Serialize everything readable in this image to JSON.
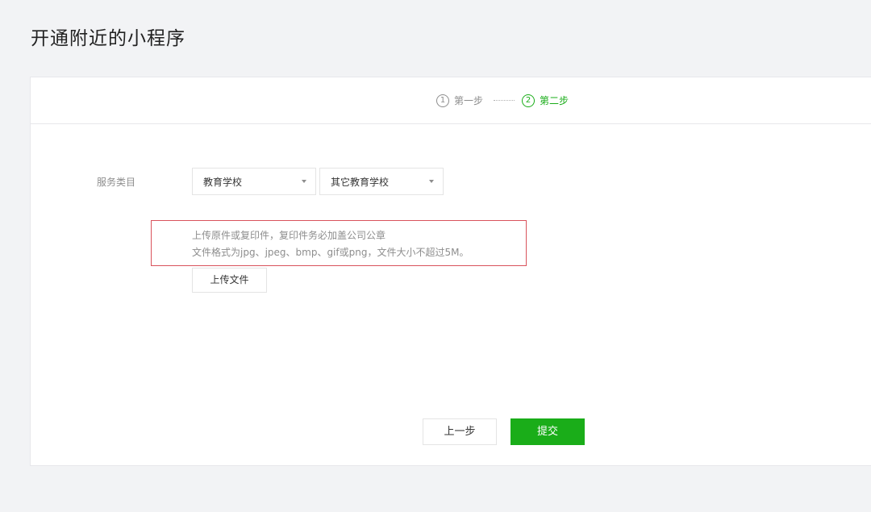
{
  "page": {
    "title": "开通附近的小程序"
  },
  "steps": [
    {
      "number": "1",
      "label": "第一步",
      "state": "done"
    },
    {
      "number": "2",
      "label": "第二步",
      "state": "active"
    }
  ],
  "form": {
    "service_category_label": "服务类目",
    "category_primary": "教育学校",
    "category_secondary": "其它教育学校",
    "upload_tip_line1": "上传原件或复印件，复印件务必加盖公司公章",
    "upload_tip_line2": "文件格式为jpg、jpeg、bmp、gif或png，文件大小不超过5M。",
    "upload_button": "上传文件"
  },
  "actions": {
    "prev_label": "上一步",
    "submit_label": "提交"
  },
  "colors": {
    "accent_green": "#1aad19",
    "highlight_red": "#d9535c",
    "muted_text": "#8d8d8d",
    "background": "#f2f3f5"
  },
  "icons": {
    "dropdown": "caret-down-icon"
  }
}
